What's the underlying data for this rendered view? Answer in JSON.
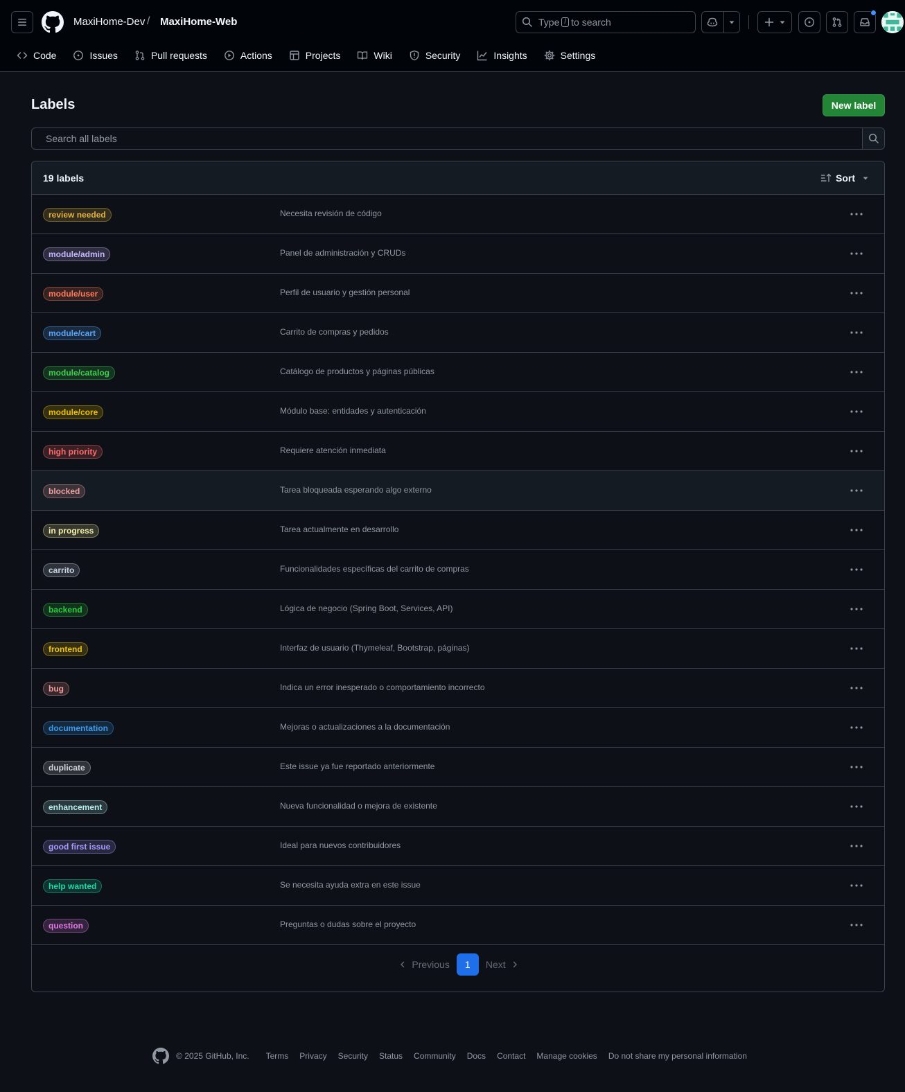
{
  "header": {
    "owner": "MaxiHome-Dev",
    "separator": "/",
    "repo": "MaxiHome-Web",
    "search": {
      "prefix": "Type",
      "key": "/",
      "suffix": "to search"
    }
  },
  "nav": [
    {
      "label": "Code",
      "icon": "code-icon"
    },
    {
      "label": "Issues",
      "icon": "issue-icon"
    },
    {
      "label": "Pull requests",
      "icon": "pull-request-icon"
    },
    {
      "label": "Actions",
      "icon": "play-icon"
    },
    {
      "label": "Projects",
      "icon": "table-icon"
    },
    {
      "label": "Wiki",
      "icon": "book-icon"
    },
    {
      "label": "Security",
      "icon": "shield-icon"
    },
    {
      "label": "Insights",
      "icon": "graph-icon"
    },
    {
      "label": "Settings",
      "icon": "gear-icon"
    }
  ],
  "main": {
    "title": "Labels",
    "new_label": "New label",
    "search_placeholder": "Search all labels",
    "count": "19 labels",
    "sort": "Sort"
  },
  "labels": [
    {
      "name": "review needed",
      "description": "Necesita revisión de código",
      "color": "#e3b341"
    },
    {
      "name": "module/admin",
      "description": "Panel de administración y CRUDs",
      "color": "#c8b5ff"
    },
    {
      "name": "module/user",
      "description": "Perfil de usuario y gestión personal",
      "color": "#ff7b5c"
    },
    {
      "name": "module/cart",
      "description": "Carrito de compras y pedidos",
      "color": "#58a6ff"
    },
    {
      "name": "module/catalog",
      "description": "Catálogo de productos y páginas públicas",
      "color": "#3fd14e"
    },
    {
      "name": "module/core",
      "description": "Módulo base: entidades y autenticación",
      "color": "#f0c000"
    },
    {
      "name": "high priority",
      "description": "Requiere atención inmediata",
      "color": "#ff6b6b"
    },
    {
      "name": "blocked",
      "description": "Tarea bloqueada esperando algo externo",
      "color": "#e8a0a0"
    },
    {
      "name": "in progress",
      "description": "Tarea actualmente en desarrollo",
      "color": "#f5f0a8"
    },
    {
      "name": "carrito",
      "description": "Funcionalidades específicas del carrito de compras",
      "color": "#c9d4e3"
    },
    {
      "name": "backend",
      "description": "Lógica de negocio (Spring Boot, Services, API)",
      "color": "#2ecc40"
    },
    {
      "name": "frontend",
      "description": "Interfaz de usuario (Thymeleaf, Bootstrap, páginas)",
      "color": "#f1c40f"
    },
    {
      "name": "bug",
      "description": "Indica un error inesperado o comportamiento incorrecto",
      "color": "#f19a9a"
    },
    {
      "name": "documentation",
      "description": "Mejoras o actualizaciones a la documentación",
      "color": "#3b9bf0"
    },
    {
      "name": "duplicate",
      "description": "Este issue ya fue reportado anteriormente",
      "color": "#d0d4da"
    },
    {
      "name": "enhancement",
      "description": "Nueva funcionalidad o mejora de existente",
      "color": "#b6f0f0"
    },
    {
      "name": "good first issue",
      "description": "Ideal para nuevos contribuidores",
      "color": "#a79bff"
    },
    {
      "name": "help wanted",
      "description": "Se necesita ayuda extra en este issue",
      "color": "#1fd8a8"
    },
    {
      "name": "question",
      "description": "Preguntas o dudas sobre el proyecto",
      "color": "#e27ae8"
    }
  ],
  "pagination": {
    "previous": "Previous",
    "current": "1",
    "next": "Next"
  },
  "footer": {
    "copyright": "© 2025 GitHub, Inc.",
    "links": [
      "Terms",
      "Privacy",
      "Security",
      "Status",
      "Community",
      "Docs",
      "Contact",
      "Manage cookies",
      "Do not share my personal information"
    ]
  }
}
